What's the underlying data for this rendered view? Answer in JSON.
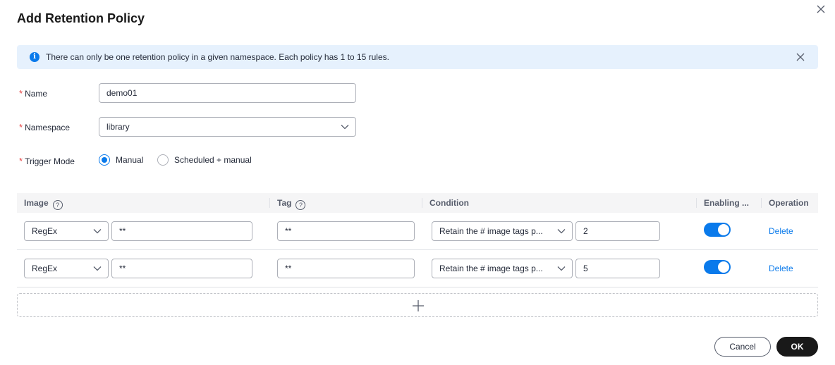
{
  "dialog": {
    "title": "Add Retention Policy",
    "close_icon": "close-icon"
  },
  "alert": {
    "icon": "info-icon",
    "icon_glyph": "i",
    "text": "There can only be one retention policy in a given namespace. Each policy has 1 to 15 rules.",
    "background": "#e6f1fd"
  },
  "form": {
    "required_mark": "*",
    "name": {
      "label": "Name",
      "value": "demo01"
    },
    "namespace": {
      "label": "Namespace",
      "value": "library"
    },
    "trigger_mode": {
      "label": "Trigger Mode",
      "options": [
        {
          "label": "Manual",
          "checked": true
        },
        {
          "label": "Scheduled + manual",
          "checked": false
        }
      ]
    }
  },
  "table": {
    "headers": {
      "image": "Image",
      "tag": "Tag",
      "condition": "Condition",
      "enabling": "Enabling ...",
      "operation": "Operation",
      "help_glyph": "?"
    },
    "rows": [
      {
        "match_type": "RegEx",
        "image": "**",
        "tag": "**",
        "condition": "Retain the # image tags p...",
        "count": "2",
        "enabled": true,
        "operation": "Delete"
      },
      {
        "match_type": "RegEx",
        "image": "**",
        "tag": "**",
        "condition": "Retain the # image tags p...",
        "count": "5",
        "enabled": true,
        "operation": "Delete"
      }
    ],
    "add_icon": "plus-icon"
  },
  "footer": {
    "cancel_label": "Cancel",
    "ok_label": "OK"
  },
  "colors": {
    "accent": "#0a7aeb",
    "required": "#e54545",
    "primary_button": "#191919"
  }
}
